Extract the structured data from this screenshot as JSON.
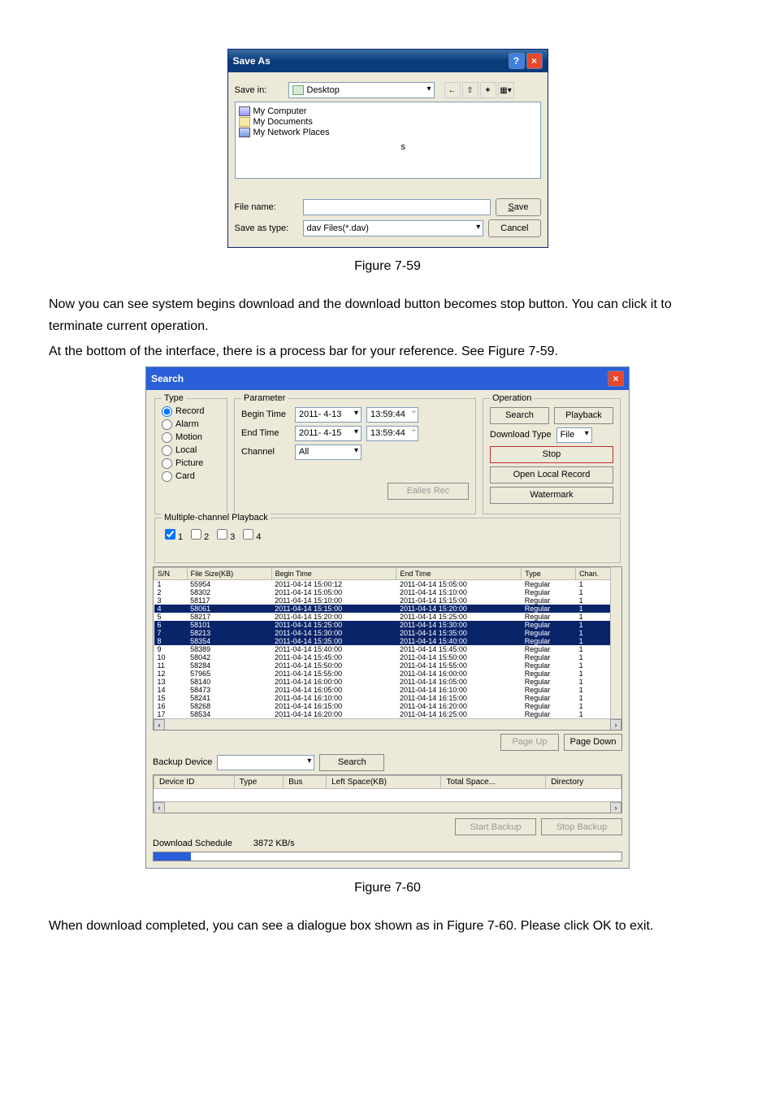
{
  "saveas": {
    "title": "Save As",
    "savein_label": "Save in:",
    "savein_value": "Desktop",
    "items": [
      "My Computer",
      "My Documents",
      "My Network Places"
    ],
    "items_extra": "s",
    "filename_label": "File name:",
    "filename_value": "",
    "saveastype_label": "Save as type:",
    "saveastype_value": "dav Files(*.dav)",
    "save_btn": "Save",
    "cancel_btn": "Cancel"
  },
  "figure59": "Figure 7-59",
  "para1": "Now you can see system begins download and the download button becomes stop button. You can click it to terminate current operation.",
  "para2": "At the bottom of the interface, there is a process bar for your reference. See Figure 7-59.",
  "search": {
    "title": "Search",
    "type_legend": "Type",
    "types": [
      "Record",
      "Alarm",
      "Motion",
      "Local",
      "Picture",
      "Card"
    ],
    "param_legend": "Parameter",
    "begin_label": "Begin Time",
    "begin_date": "2011- 4-13",
    "begin_time": "13:59:44",
    "end_label": "End Time",
    "end_date": "2011- 4-15",
    "end_time": "13:59:44",
    "channel_label": "Channel",
    "channel_value": "All",
    "ealies_btn": "Ealies Rec",
    "op_legend": "Operation",
    "search_btn": "Search",
    "playback_btn": "Playback",
    "dltype_label": "Download Type",
    "dltype_value": "File",
    "stop_btn": "Stop",
    "openlocal_btn": "Open Local Record",
    "watermark_btn": "Watermark",
    "multi_legend": "Multiple-channel Playback",
    "multi_ch": [
      "1",
      "2",
      "3",
      "4"
    ],
    "cols": [
      "S/N",
      "File Size(KB)",
      "Begin Time",
      "End Time",
      "Type",
      "Chan."
    ],
    "rows": [
      {
        "sn": "1",
        "size": "55954",
        "bt": "2011-04-14 15:00:12",
        "et": "2011-04-14 15:05:00",
        "type": "Regular",
        "ch": "1",
        "hl": false
      },
      {
        "sn": "2",
        "size": "58302",
        "bt": "2011-04-14 15:05:00",
        "et": "2011-04-14 15:10:00",
        "type": "Regular",
        "ch": "1",
        "hl": false
      },
      {
        "sn": "3",
        "size": "58117",
        "bt": "2011-04-14 15:10:00",
        "et": "2011-04-14 15:15:00",
        "type": "Regular",
        "ch": "1",
        "hl": false
      },
      {
        "sn": "4",
        "size": "58061",
        "bt": "2011-04-14 15:15:00",
        "et": "2011-04-14 15:20:00",
        "type": "Regular",
        "ch": "1",
        "hl": true
      },
      {
        "sn": "5",
        "size": "58217",
        "bt": "2011-04-14 15:20:00",
        "et": "2011-04-14 15:25:00",
        "type": "Regular",
        "ch": "1",
        "hl": false
      },
      {
        "sn": "6",
        "size": "58101",
        "bt": "2011-04-14 15:25:00",
        "et": "2011-04-14 15:30:00",
        "type": "Regular",
        "ch": "1",
        "hl": true
      },
      {
        "sn": "7",
        "size": "58213",
        "bt": "2011-04-14 15:30:00",
        "et": "2011-04-14 15:35:00",
        "type": "Regular",
        "ch": "1",
        "hl": true
      },
      {
        "sn": "8",
        "size": "58354",
        "bt": "2011-04-14 15:35:00",
        "et": "2011-04-14 15:40:00",
        "type": "Regular",
        "ch": "1",
        "hl": true
      },
      {
        "sn": "9",
        "size": "58389",
        "bt": "2011-04-14 15:40:00",
        "et": "2011-04-14 15:45:00",
        "type": "Regular",
        "ch": "1",
        "hl": false
      },
      {
        "sn": "10",
        "size": "58042",
        "bt": "2011-04-14 15:45:00",
        "et": "2011-04-14 15:50:00",
        "type": "Regular",
        "ch": "1",
        "hl": false
      },
      {
        "sn": "11",
        "size": "58284",
        "bt": "2011-04-14 15:50:00",
        "et": "2011-04-14 15:55:00",
        "type": "Regular",
        "ch": "1",
        "hl": false
      },
      {
        "sn": "12",
        "size": "57965",
        "bt": "2011-04-14 15:55:00",
        "et": "2011-04-14 16:00:00",
        "type": "Regular",
        "ch": "1",
        "hl": false
      },
      {
        "sn": "13",
        "size": "58140",
        "bt": "2011-04-14 16:00:00",
        "et": "2011-04-14 16:05:00",
        "type": "Regular",
        "ch": "1",
        "hl": false
      },
      {
        "sn": "14",
        "size": "58473",
        "bt": "2011-04-14 16:05:00",
        "et": "2011-04-14 16:10:00",
        "type": "Regular",
        "ch": "1",
        "hl": false
      },
      {
        "sn": "15",
        "size": "58241",
        "bt": "2011-04-14 16:10:00",
        "et": "2011-04-14 16:15:00",
        "type": "Regular",
        "ch": "1",
        "hl": false
      },
      {
        "sn": "16",
        "size": "58268",
        "bt": "2011-04-14 16:15:00",
        "et": "2011-04-14 16:20:00",
        "type": "Regular",
        "ch": "1",
        "hl": false
      },
      {
        "sn": "17",
        "size": "58534",
        "bt": "2011-04-14 16:20:00",
        "et": "2011-04-14 16:25:00",
        "type": "Regular",
        "ch": "1",
        "hl": false
      }
    ],
    "pageup": "Page Up",
    "pagedown": "Page Down",
    "backup_label": "Backup Device",
    "backup_search": "Search",
    "devcols": [
      "Device ID",
      "Type",
      "Bus",
      "Left Space(KB)",
      "Total Space...",
      "Directory"
    ],
    "dlsched": "Download Schedule",
    "speed": "3872 KB/s",
    "startbackup": "Start Backup",
    "stopbackup": "Stop Backup"
  },
  "figure60": "Figure 7-60",
  "para3": "When download completed, you can see a dialogue box shown as in Figure 7-60. Please click OK to exit."
}
